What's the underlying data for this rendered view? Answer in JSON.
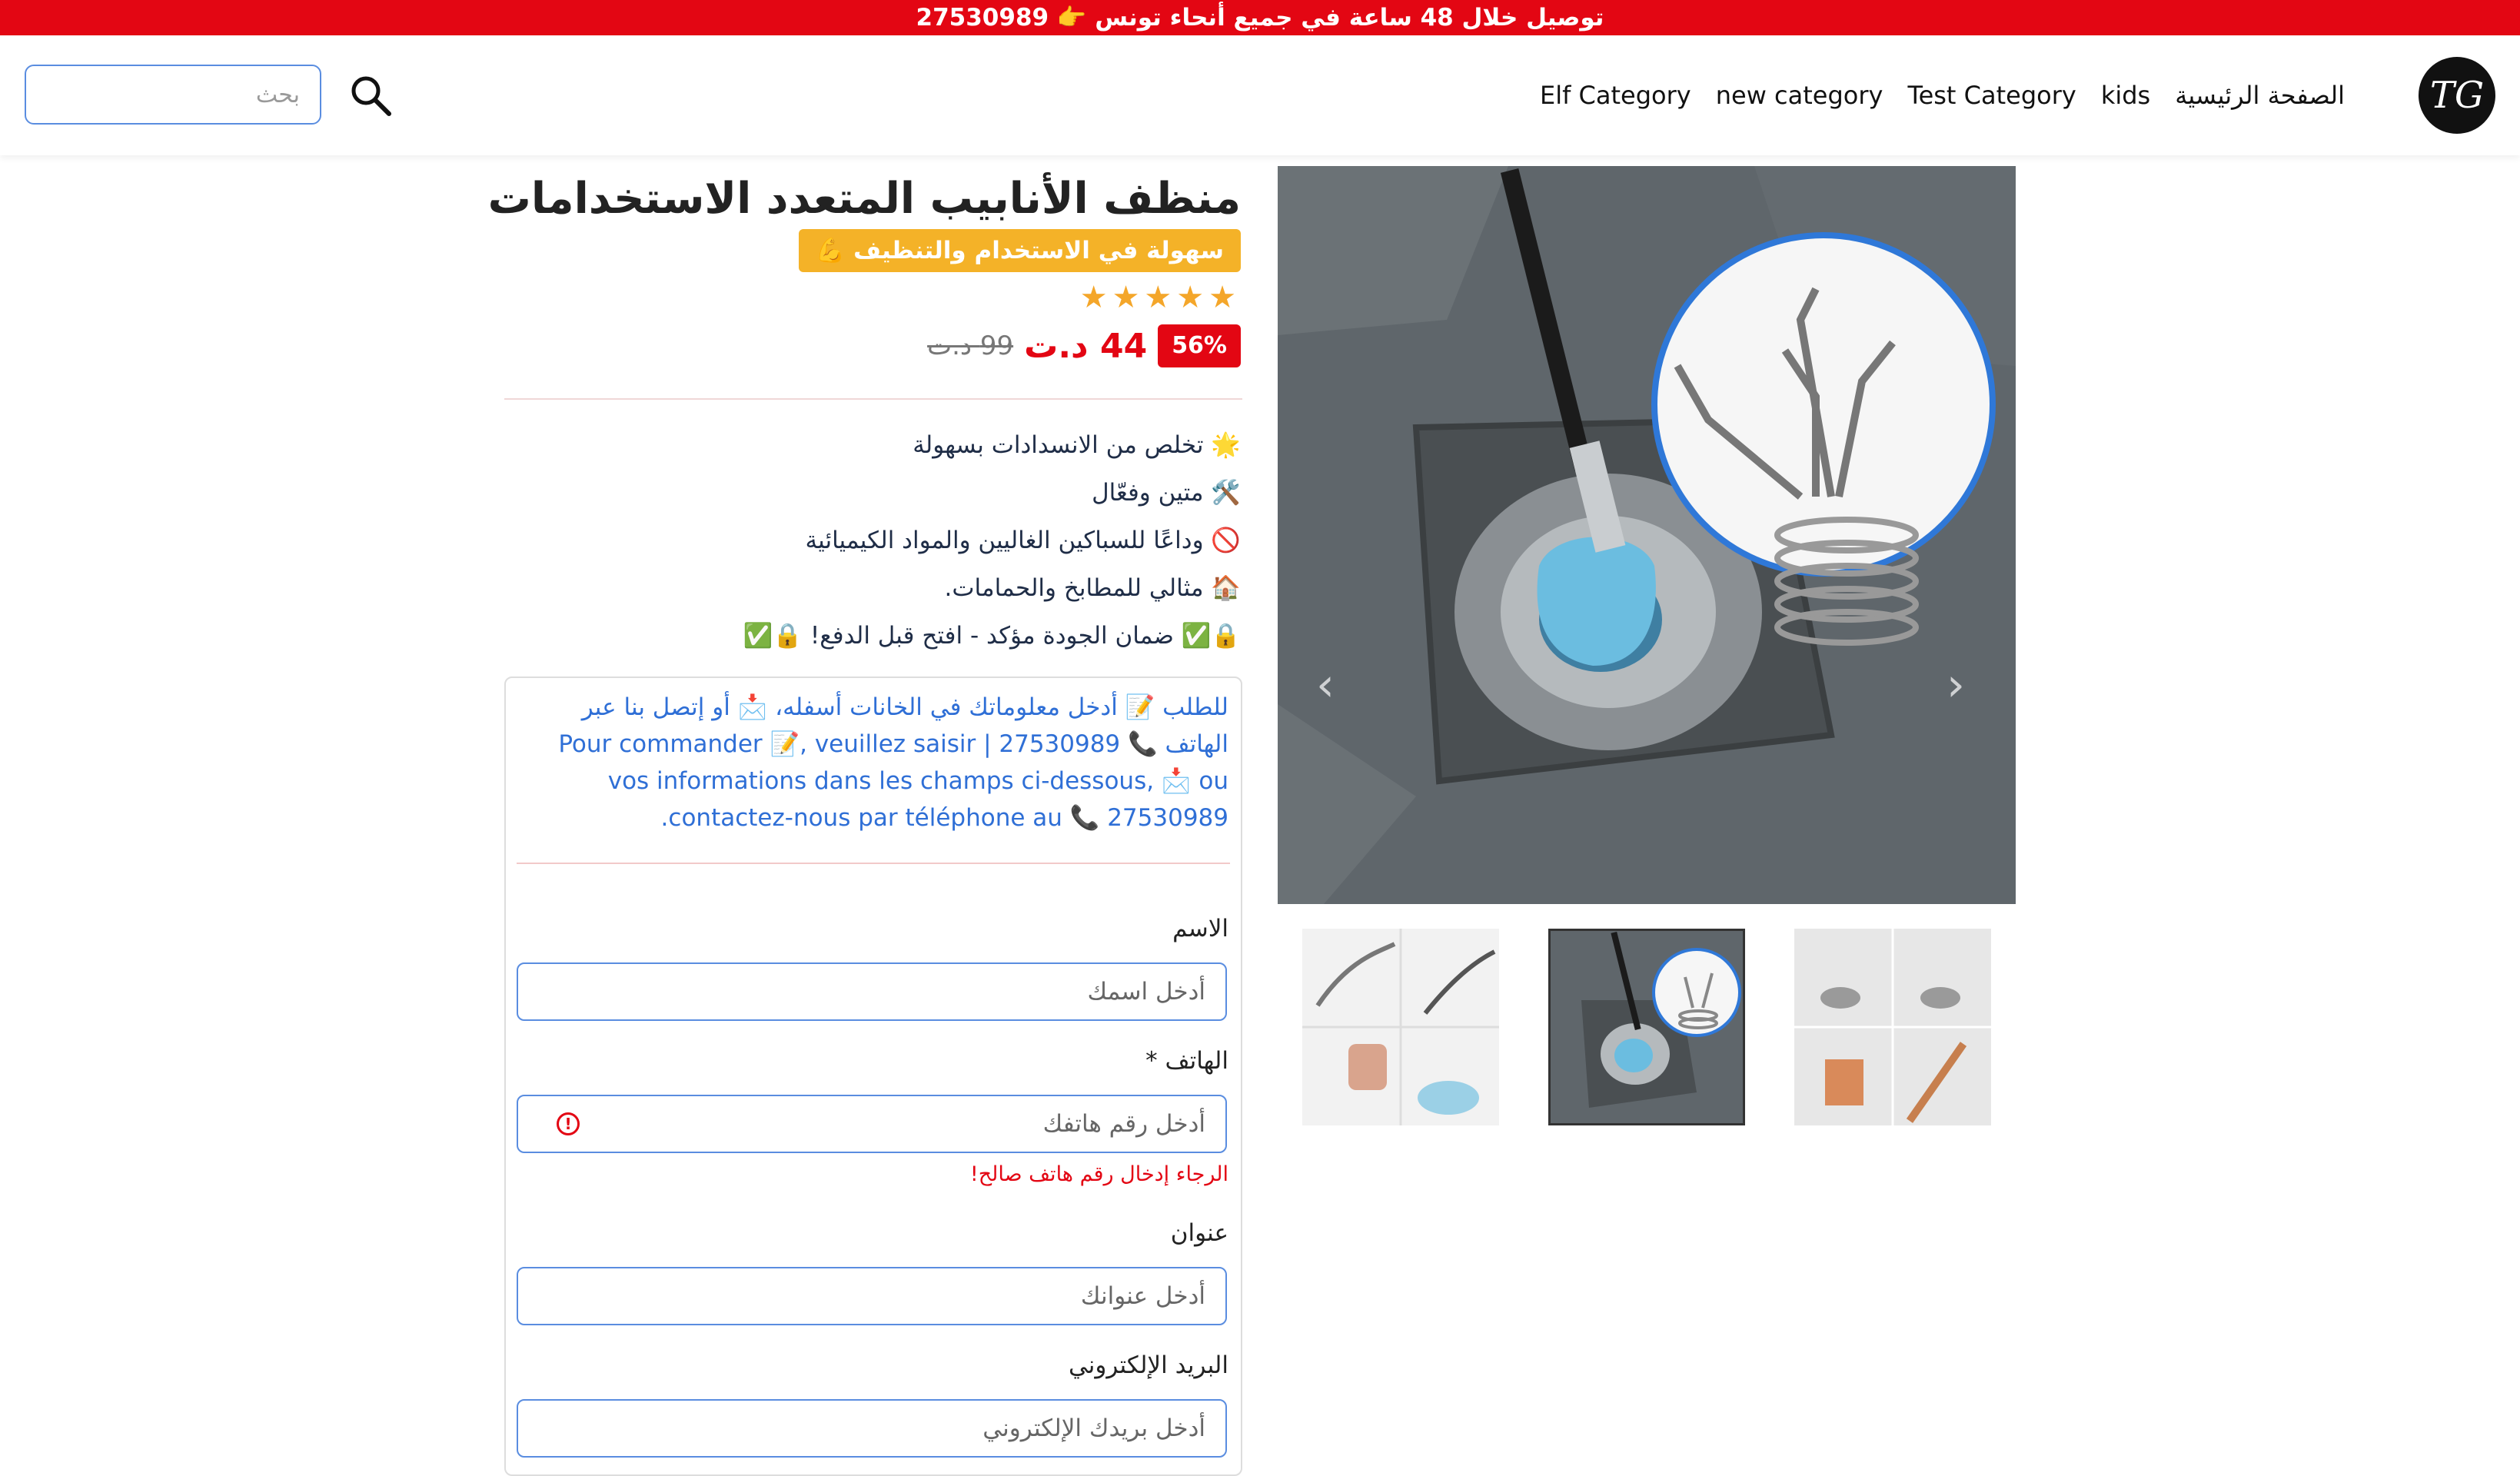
{
  "announcement": "توصيل خلال 48 ساعة في جميع أنحاء تونس 👉 27530989",
  "header": {
    "search_placeholder": "بحث",
    "logo_text": "TG",
    "nav": [
      "الصفحة الرئيسية",
      "kids",
      "Test Category",
      "new category",
      "Elf Category"
    ]
  },
  "product": {
    "title": "منظف الأنابيب المتعدد الاستخدامات",
    "tagline": "💪 سهولة في الاستخدام والتنظيف",
    "stars": "★★★★★",
    "rating": 5,
    "discount": "56%",
    "price": "44 د.ت",
    "old_price": "99 د.ت",
    "features": [
      "🌟 تخلص من الانسدادات بسهولة",
      "🛠️ متين وفعّال",
      "🚫 وداعًا للسباكين الغاليين والمواد الكيميائية",
      "🏠 مثالي للمطابخ والحمامات.",
      "🔒✅ ضمان الجودة مؤكد - افتح قبل الدفع! 🔒✅"
    ]
  },
  "order": {
    "info_ar": "للطلب 📝 أدخل معلوماتك في الخانات أسفله، 📩 أو إتصل بنا عبر الهاتف 📞 27530989 | Pour commander 📝, veuillez saisir vos informations dans les champs ci-dessous, 📩 ou contactez-nous par téléphone au 📞 27530989.",
    "name_label": "الاسم",
    "name_placeholder": "أدخل اسمك",
    "phone_label": "الهاتف *",
    "phone_placeholder": "أدخل رقم هاتفك",
    "phone_error": "الرجاء إدخال رقم هاتف صالح!",
    "address_label": "عنوان",
    "address_placeholder": "أدخل عنوانك",
    "email_label": "البريد الإلكتروني",
    "email_placeholder": "أدخل بريدك الإلكتروني"
  },
  "colors": {
    "accent": "#e30613",
    "badge": "#f4b228",
    "link": "#2f6fd6"
  }
}
